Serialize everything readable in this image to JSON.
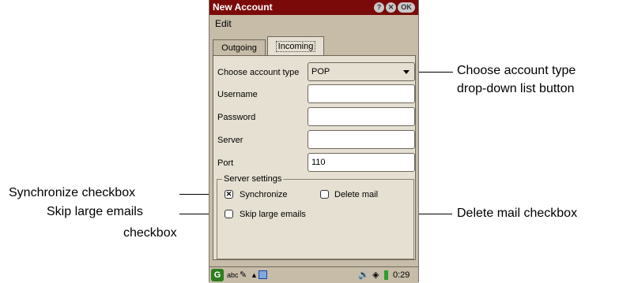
{
  "window": {
    "title": "New Account",
    "help_btn": "?",
    "close_btn": "✕",
    "ok_btn": "OK"
  },
  "menu": {
    "edit": "Edit"
  },
  "tabs": [
    {
      "label": "Outgoing"
    },
    {
      "label": "Incoming"
    }
  ],
  "form": {
    "account_type_label": "Choose account type",
    "account_type_value": "POP",
    "username_label": "Username",
    "username_value": "",
    "password_label": "Password",
    "password_value": "",
    "server_label": "Server",
    "server_value": "",
    "port_label": "Port",
    "port_value": "110"
  },
  "server_settings": {
    "legend": "Server settings",
    "synchronize_label": "Synchronize",
    "synchronize_checked": true,
    "delete_mail_label": "Delete mail",
    "delete_mail_checked": false,
    "skip_large_label": "Skip large emails",
    "skip_large_checked": false
  },
  "taskbar": {
    "input_mode": "abc",
    "clock": "0:29"
  },
  "callouts": {
    "account_type": [
      "Choose account type",
      "drop-down list button"
    ],
    "synchronize": "Synchronize checkbox",
    "skip_large": [
      "Skip large emails",
      "checkbox"
    ],
    "delete_mail": "Delete mail checkbox"
  },
  "colors": {
    "titlebar": "#7a0a0a",
    "background": "#c6bca8",
    "panel": "#e6e0d2"
  }
}
